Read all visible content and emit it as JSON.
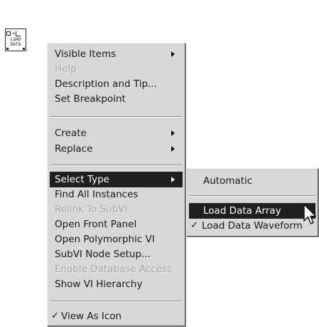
{
  "vi_icon": {
    "text_line1": "LOAD",
    "text_line2": "DATA",
    "arrow_glyph": "→"
  },
  "main_menu": {
    "items": [
      {
        "label": "Visible Items",
        "disabled": false,
        "submenu": true
      },
      {
        "label": "Help",
        "disabled": true,
        "submenu": false
      },
      {
        "label": "Description and Tip...",
        "disabled": false,
        "submenu": false
      },
      {
        "label": "Set Breakpoint",
        "disabled": false,
        "submenu": false
      },
      {
        "label": "Create",
        "disabled": false,
        "submenu": true
      },
      {
        "label": "Replace",
        "disabled": false,
        "submenu": true
      },
      {
        "label": "Select Type",
        "disabled": false,
        "submenu": true,
        "selected": true
      },
      {
        "label": "Find All Instances",
        "disabled": false,
        "submenu": false
      },
      {
        "label": "Relink To SubVI",
        "disabled": true,
        "submenu": false
      },
      {
        "label": "Open Front Panel",
        "disabled": false,
        "submenu": false
      },
      {
        "label": "Open Polymorphic VI",
        "disabled": false,
        "submenu": false
      },
      {
        "label": "SubVI Node Setup...",
        "disabled": false,
        "submenu": false
      },
      {
        "label": "Enable Database Access",
        "disabled": true,
        "submenu": false
      },
      {
        "label": "Show VI Hierarchy",
        "disabled": false,
        "submenu": false
      },
      {
        "label": "View As Icon",
        "disabled": false,
        "submenu": false,
        "checked": true
      }
    ],
    "check_glyph": "✓"
  },
  "sub_menu": {
    "items": [
      {
        "label": "Automatic"
      },
      {
        "label": "Load Data Array",
        "selected": true
      },
      {
        "label": "Load Data Waveform",
        "checked": true
      }
    ],
    "check_glyph": "✓"
  },
  "colors": {
    "menu_bg": "#d8d8d8",
    "highlight_bg": "#1f1f1f",
    "highlight_text": "#ffffff",
    "disabled_text": "#a6a6a6"
  }
}
